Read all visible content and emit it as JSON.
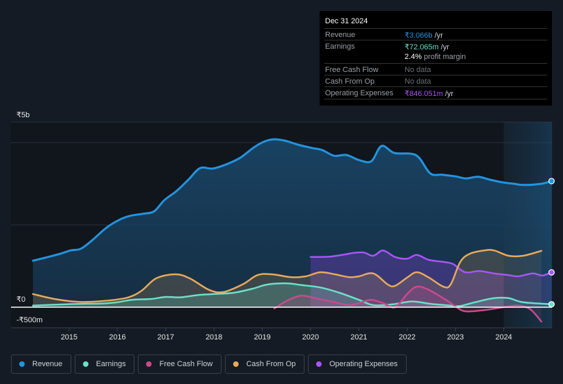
{
  "tooltip": {
    "date": "Dec 31 2024",
    "rows": [
      {
        "label": "Revenue",
        "value": "₹3.066b",
        "unit": " /yr",
        "color": "#2394df"
      },
      {
        "label": "Earnings",
        "value": "₹72.065m",
        "unit": " /yr",
        "color": "#6ce0c8"
      },
      {
        "label": "Free Cash Flow",
        "value": "No data",
        "unit": "",
        "color": "#6b7077"
      },
      {
        "label": "Cash From Op",
        "value": "No data",
        "unit": "",
        "color": "#6b7077"
      },
      {
        "label": "Operating Expenses",
        "value": "₹846.051m",
        "unit": " /yr",
        "color": "#a855f7"
      }
    ],
    "margin_value": "2.4%",
    "margin_label": " profit margin"
  },
  "legend": [
    {
      "label": "Revenue",
      "color": "#2394df"
    },
    {
      "label": "Earnings",
      "color": "#6ce0c8"
    },
    {
      "label": "Free Cash Flow",
      "color": "#c84b8c"
    },
    {
      "label": "Cash From Op",
      "color": "#e8aa5c"
    },
    {
      "label": "Operating Expenses",
      "color": "#a855f7"
    }
  ],
  "chart_data": {
    "type": "area",
    "title": "",
    "xlabel": "",
    "ylabel": "",
    "currency": "₹",
    "ylim": [
      -0.5,
      5
    ],
    "y_unit": "billions",
    "y_tick_labels": [
      {
        "value": 5,
        "label": "₹5b"
      },
      {
        "value": 0,
        "label": "₹0"
      },
      {
        "value": -0.5,
        "label": "-₹500m"
      }
    ],
    "gridlines": [
      2,
      4
    ],
    "xlim": [
      2014.25,
      2025.0
    ],
    "x_ticks": [
      2015,
      2016,
      2017,
      2018,
      2019,
      2020,
      2021,
      2022,
      2023,
      2024
    ],
    "highlight_range": [
      2024.0,
      2025.0
    ],
    "legend_position": "bottom",
    "series": [
      {
        "name": "Revenue",
        "color": "#2394df",
        "points": [
          [
            2014.25,
            1.13
          ],
          [
            2014.56,
            1.22
          ],
          [
            2014.82,
            1.3
          ],
          [
            2015.03,
            1.38
          ],
          [
            2015.24,
            1.42
          ],
          [
            2015.48,
            1.63
          ],
          [
            2015.77,
            1.93
          ],
          [
            2016.05,
            2.13
          ],
          [
            2016.26,
            2.22
          ],
          [
            2016.52,
            2.27
          ],
          [
            2016.76,
            2.33
          ],
          [
            2016.97,
            2.6
          ],
          [
            2017.23,
            2.83
          ],
          [
            2017.47,
            3.1
          ],
          [
            2017.71,
            3.38
          ],
          [
            2017.97,
            3.37
          ],
          [
            2018.25,
            3.47
          ],
          [
            2018.54,
            3.63
          ],
          [
            2018.82,
            3.88
          ],
          [
            2019.03,
            4.02
          ],
          [
            2019.22,
            4.08
          ],
          [
            2019.46,
            4.05
          ],
          [
            2019.74,
            3.95
          ],
          [
            2020.03,
            3.87
          ],
          [
            2020.24,
            3.82
          ],
          [
            2020.49,
            3.68
          ],
          [
            2020.74,
            3.7
          ],
          [
            2021.02,
            3.57
          ],
          [
            2021.26,
            3.55
          ],
          [
            2021.47,
            3.92
          ],
          [
            2021.73,
            3.75
          ],
          [
            2022.08,
            3.73
          ],
          [
            2022.25,
            3.63
          ],
          [
            2022.48,
            3.25
          ],
          [
            2022.72,
            3.22
          ],
          [
            2023.0,
            3.18
          ],
          [
            2023.22,
            3.13
          ],
          [
            2023.47,
            3.17
          ],
          [
            2023.71,
            3.1
          ],
          [
            2024.0,
            3.03
          ],
          [
            2024.21,
            3.0
          ],
          [
            2024.42,
            2.97
          ],
          [
            2024.78,
            3.0
          ],
          [
            2024.99,
            3.066
          ]
        ]
      },
      {
        "name": "Earnings",
        "color": "#6ce0c8",
        "points": [
          [
            2014.25,
            0.04
          ],
          [
            2014.7,
            0.06
          ],
          [
            2015.2,
            0.08
          ],
          [
            2015.7,
            0.09
          ],
          [
            2016.0,
            0.12
          ],
          [
            2016.3,
            0.18
          ],
          [
            2016.7,
            0.2
          ],
          [
            2017.0,
            0.25
          ],
          [
            2017.3,
            0.24
          ],
          [
            2017.7,
            0.3
          ],
          [
            2018.0,
            0.32
          ],
          [
            2018.4,
            0.35
          ],
          [
            2018.8,
            0.45
          ],
          [
            2019.1,
            0.55
          ],
          [
            2019.5,
            0.58
          ],
          [
            2019.8,
            0.54
          ],
          [
            2020.2,
            0.48
          ],
          [
            2020.6,
            0.35
          ],
          [
            2021.0,
            0.18
          ],
          [
            2021.3,
            0.05
          ],
          [
            2021.7,
            0.07
          ],
          [
            2022.1,
            0.14
          ],
          [
            2022.5,
            0.08
          ],
          [
            2022.9,
            0.04
          ],
          [
            2023.1,
            0.03
          ],
          [
            2023.4,
            0.12
          ],
          [
            2023.8,
            0.22
          ],
          [
            2024.1,
            0.22
          ],
          [
            2024.4,
            0.12
          ],
          [
            2024.99,
            0.072
          ]
        ]
      },
      {
        "name": "Free Cash Flow",
        "color": "#c84b8c",
        "points": [
          [
            2019.25,
            -0.03
          ],
          [
            2019.5,
            0.15
          ],
          [
            2019.8,
            0.28
          ],
          [
            2020.1,
            0.22
          ],
          [
            2020.5,
            0.12
          ],
          [
            2020.8,
            0.05
          ],
          [
            2021.0,
            0.1
          ],
          [
            2021.25,
            0.18
          ],
          [
            2021.5,
            0.1
          ],
          [
            2021.75,
            0.0
          ],
          [
            2022.0,
            0.32
          ],
          [
            2022.2,
            0.5
          ],
          [
            2022.45,
            0.42
          ],
          [
            2022.8,
            0.18
          ],
          [
            2023.0,
            0.02
          ],
          [
            2023.2,
            -0.1
          ],
          [
            2023.6,
            -0.07
          ],
          [
            2024.0,
            0.0
          ],
          [
            2024.3,
            0.04
          ],
          [
            2024.55,
            -0.05
          ],
          [
            2024.78,
            -0.35
          ]
        ]
      },
      {
        "name": "Cash From Op",
        "color": "#e8aa5c",
        "points": [
          [
            2014.25,
            0.32
          ],
          [
            2014.7,
            0.2
          ],
          [
            2015.2,
            0.13
          ],
          [
            2015.7,
            0.15
          ],
          [
            2016.2,
            0.23
          ],
          [
            2016.5,
            0.4
          ],
          [
            2016.8,
            0.7
          ],
          [
            2017.2,
            0.8
          ],
          [
            2017.5,
            0.7
          ],
          [
            2017.9,
            0.42
          ],
          [
            2018.2,
            0.37
          ],
          [
            2018.6,
            0.56
          ],
          [
            2018.9,
            0.78
          ],
          [
            2019.2,
            0.8
          ],
          [
            2019.6,
            0.73
          ],
          [
            2019.9,
            0.75
          ],
          [
            2020.2,
            0.85
          ],
          [
            2020.5,
            0.8
          ],
          [
            2020.8,
            0.73
          ],
          [
            2021.0,
            0.75
          ],
          [
            2021.3,
            0.82
          ],
          [
            2021.6,
            0.55
          ],
          [
            2021.75,
            0.52
          ],
          [
            2022.0,
            0.72
          ],
          [
            2022.2,
            0.85
          ],
          [
            2022.45,
            0.72
          ],
          [
            2022.75,
            0.5
          ],
          [
            2022.9,
            0.55
          ],
          [
            2023.1,
            1.1
          ],
          [
            2023.3,
            1.3
          ],
          [
            2023.6,
            1.38
          ],
          [
            2023.8,
            1.38
          ],
          [
            2024.1,
            1.25
          ],
          [
            2024.4,
            1.25
          ],
          [
            2024.78,
            1.37
          ]
        ]
      },
      {
        "name": "Operating Expenses",
        "color": "#a855f7",
        "points": [
          [
            2020.0,
            1.22
          ],
          [
            2020.4,
            1.23
          ],
          [
            2020.7,
            1.28
          ],
          [
            2020.9,
            1.32
          ],
          [
            2021.1,
            1.33
          ],
          [
            2021.3,
            1.25
          ],
          [
            2021.5,
            1.38
          ],
          [
            2021.75,
            1.22
          ],
          [
            2022.0,
            1.18
          ],
          [
            2022.2,
            1.27
          ],
          [
            2022.45,
            1.15
          ],
          [
            2022.75,
            1.1
          ],
          [
            2022.95,
            1.05
          ],
          [
            2023.2,
            0.85
          ],
          [
            2023.5,
            0.88
          ],
          [
            2023.8,
            0.82
          ],
          [
            2024.1,
            0.78
          ],
          [
            2024.3,
            0.75
          ],
          [
            2024.6,
            0.82
          ],
          [
            2024.8,
            0.77
          ],
          [
            2024.99,
            0.846
          ]
        ]
      }
    ]
  }
}
